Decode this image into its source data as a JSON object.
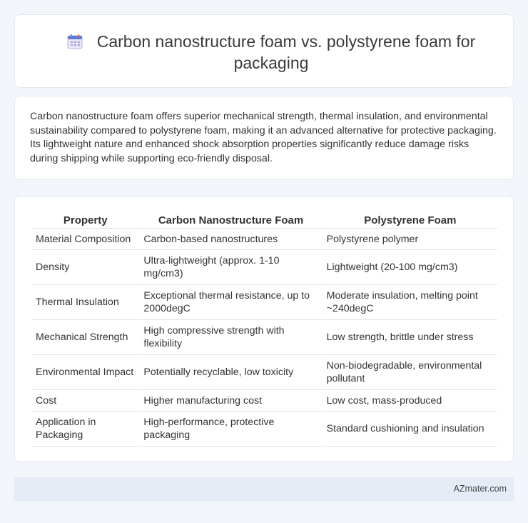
{
  "header": {
    "title": "Carbon nanostructure foam vs. polystyrene foam for packaging",
    "icon": "calendar-icon"
  },
  "summary": {
    "text": "Carbon nanostructure foam offers superior mechanical strength, thermal insulation, and environmental sustainability compared to polystyrene foam, making it an advanced alternative for protective packaging. Its lightweight nature and enhanced shock absorption properties significantly reduce damage risks during shipping while supporting eco-friendly disposal."
  },
  "table": {
    "headers": [
      "Property",
      "Carbon Nanostructure Foam",
      "Polystyrene Foam"
    ],
    "rows": [
      [
        "Material Composition",
        "Carbon-based nanostructures",
        "Polystyrene polymer"
      ],
      [
        "Density",
        "Ultra-lightweight (approx. 1-10 mg/cm3)",
        "Lightweight (20-100 mg/cm3)"
      ],
      [
        "Thermal Insulation",
        "Exceptional thermal resistance, up to 2000degC",
        "Moderate insulation, melting point ~240degC"
      ],
      [
        "Mechanical Strength",
        "High compressive strength with flexibility",
        "Low strength, brittle under stress"
      ],
      [
        "Environmental Impact",
        "Potentially recyclable, low toxicity",
        "Non-biodegradable, environmental pollutant"
      ],
      [
        "Cost",
        "Higher manufacturing cost",
        "Low cost, mass-produced"
      ],
      [
        "Application in Packaging",
        "High-performance, protective packaging",
        "Standard cushioning and insulation"
      ]
    ]
  },
  "footer": {
    "site": "AZmater.com"
  },
  "colors": {
    "background": "#f2f5fa",
    "card": "#ffffff",
    "footer": "#e6ecf6",
    "icon_accent": "#5b7bd5"
  }
}
